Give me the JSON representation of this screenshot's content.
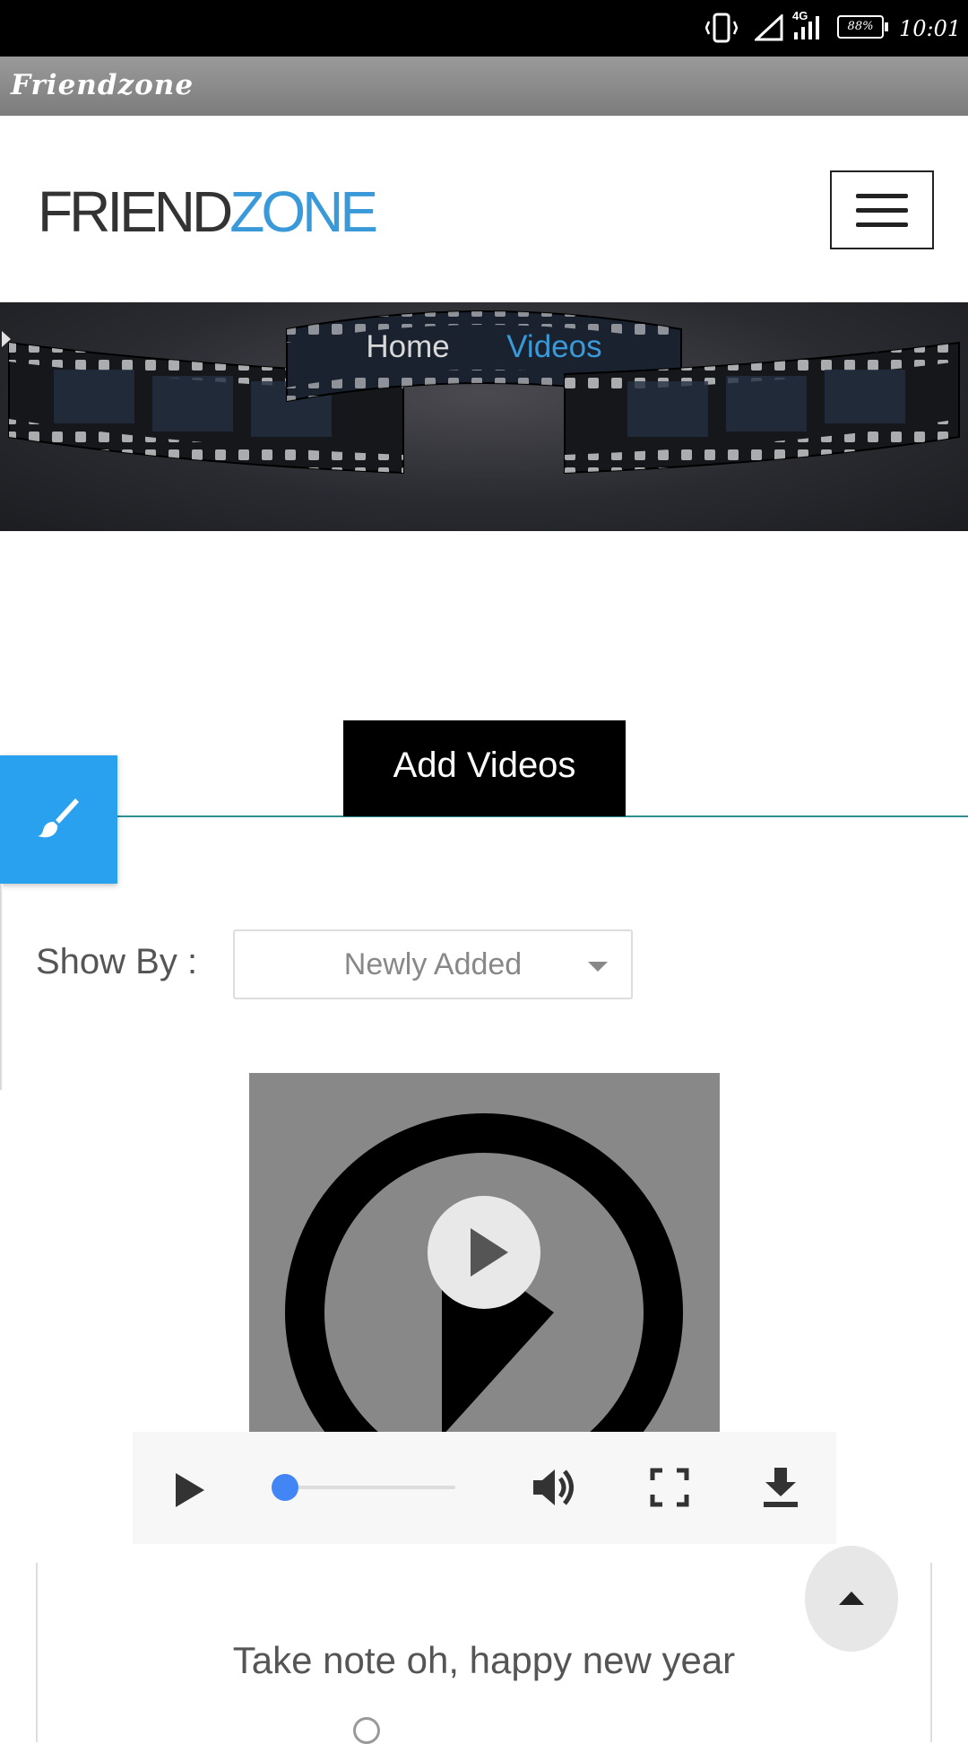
{
  "status_bar": {
    "network": "4G",
    "battery": "88%",
    "time": "10:01"
  },
  "app_bar": {
    "title": "Friendzone"
  },
  "header": {
    "logo_part1": "FRIEND",
    "logo_part2": "ZONE",
    "menu_icon": "hamburger-icon"
  },
  "breadcrumb": {
    "home": "Home",
    "current": "Videos"
  },
  "actions": {
    "add_videos": "Add Videos",
    "side_tab_icon": "paintbrush-icon"
  },
  "filter": {
    "label": "Show By :",
    "selected": "Newly Added"
  },
  "video": {
    "progress": 0,
    "controls": [
      "play-icon",
      "volume-icon",
      "fullscreen-icon",
      "download-icon"
    ]
  },
  "card": {
    "title": "Take note oh, happy new year"
  },
  "colors": {
    "accent_blue": "#3a9ad9",
    "side_tab": "#2aa1ef",
    "tab_line": "#2f8f8f",
    "progress_knob": "#4285f4"
  }
}
